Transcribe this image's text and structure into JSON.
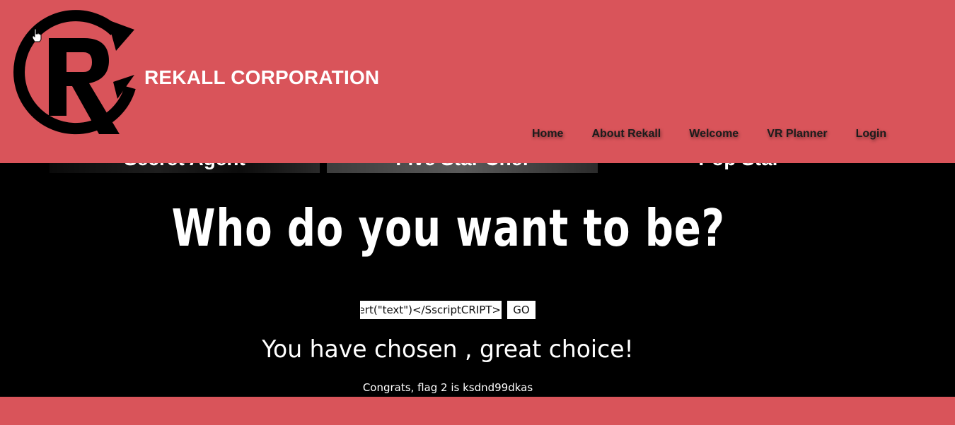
{
  "brand": {
    "name": "REKALL CORPORATION",
    "logo_icon": "rekall-r-logo-icon"
  },
  "nav": {
    "items": [
      {
        "label": "Home"
      },
      {
        "label": "About Rekall"
      },
      {
        "label": "Welcome"
      },
      {
        "label": "VR Planner"
      },
      {
        "label": "Login"
      }
    ]
  },
  "strip": {
    "tiles": [
      {
        "label": "Secret Agent"
      },
      {
        "label": "Five Star Chef"
      },
      {
        "label": "Pop Star"
      }
    ]
  },
  "main": {
    "headline": "Who do you want to be?",
    "input_value": "<SCRIPscriptT>alert(\"text\")</SscriptCRIPT>",
    "go_label": "GO",
    "result": "You have chosen , great choice!",
    "flag": "Congrats, flag 2 is ksdnd99dkas"
  },
  "colors": {
    "header_bg": "#d9545a",
    "main_bg": "#000000",
    "brand_text": "#ffffff",
    "nav_text": "#1c1c1c"
  }
}
